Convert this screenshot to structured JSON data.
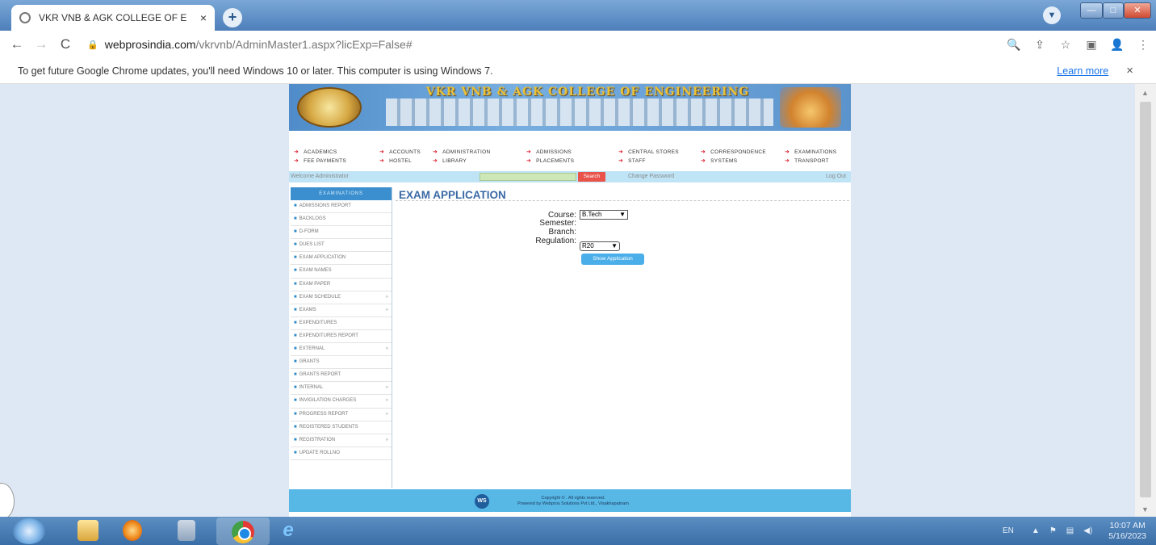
{
  "browser": {
    "tab_title": "VKR VNB & AGK COLLEGE OF E",
    "tab_close": "×",
    "new_tab": "+",
    "url_host": "webprosindia.com",
    "url_path": "/vkrvnb/AdminMaster1.aspx?licExp=False#",
    "infobar_message": "To get future Google Chrome updates, you'll need Windows 10 or later. This computer is using Windows 7.",
    "infobar_link": "Learn more",
    "infobar_close": "×"
  },
  "site": {
    "college_name": "VKR VNB & AGK COLLEGE OF ENGINEERING",
    "menu": [
      "ACADEMICS",
      "ACCOUNTS",
      "ADMINISTRATION",
      "ADMISSIONS",
      "CENTRAL STORES",
      "CORRESPONDENCE",
      "EXAMINATIONS",
      "FEE PAYMENTS",
      "HOSTEL",
      "LIBRARY",
      "PLACEMENTS",
      "STAFF",
      "SYSTEMS",
      "TRANSPORT"
    ],
    "welcome_text": "Welcome Administrator",
    "search_button": "Search",
    "change_password": "Change Password",
    "logout": "Log Out",
    "sidebar_title": "EXAMINATIONS",
    "sidebar_items": [
      {
        "label": "ADMISSIONS REPORT",
        "sub": ""
      },
      {
        "label": "BACKLOGS",
        "sub": ""
      },
      {
        "label": "D-FORM",
        "sub": ""
      },
      {
        "label": "DUES LIST",
        "sub": ""
      },
      {
        "label": "EXAM APPLICATION",
        "sub": ""
      },
      {
        "label": "EXAM NAMES",
        "sub": ""
      },
      {
        "label": "EXAM PAPER",
        "sub": ""
      },
      {
        "label": "EXAM SCHEDULE",
        "sub": "»"
      },
      {
        "label": "EXAMS",
        "sub": "»"
      },
      {
        "label": "EXPENDITURES",
        "sub": ""
      },
      {
        "label": "EXPENDITURES REPORT",
        "sub": ""
      },
      {
        "label": "EXTERNAL",
        "sub": "»"
      },
      {
        "label": "GRANTS",
        "sub": ""
      },
      {
        "label": "GRANTS REPORT",
        "sub": ""
      },
      {
        "label": "INTERNAL",
        "sub": "»"
      },
      {
        "label": "INVIGILATION CHARGES",
        "sub": "»"
      },
      {
        "label": "PROGRESS REPORT",
        "sub": "»"
      },
      {
        "label": "REGISTERED STUDENTS",
        "sub": ""
      },
      {
        "label": "REGISTRATION",
        "sub": "»"
      },
      {
        "label": "UPDATE ROLLNO",
        "sub": ""
      }
    ],
    "page_title": "EXAM APPLICATION",
    "form": {
      "course_label": "Course:",
      "course_value": "B.Tech",
      "semester_label": "Semester:",
      "branch_label": "Branch:",
      "regulation_label": "Regulation:",
      "regulation_value": "R20",
      "show_button": "Show Application"
    },
    "footer_line1": "Copyright © . All rights reserved.",
    "footer_line2": "Powered by Webpros Solutions Pvt Ltd., Visakhapatnam"
  },
  "taskbar": {
    "lang": "EN",
    "time": "10:07 AM",
    "date": "5/16/2023"
  }
}
